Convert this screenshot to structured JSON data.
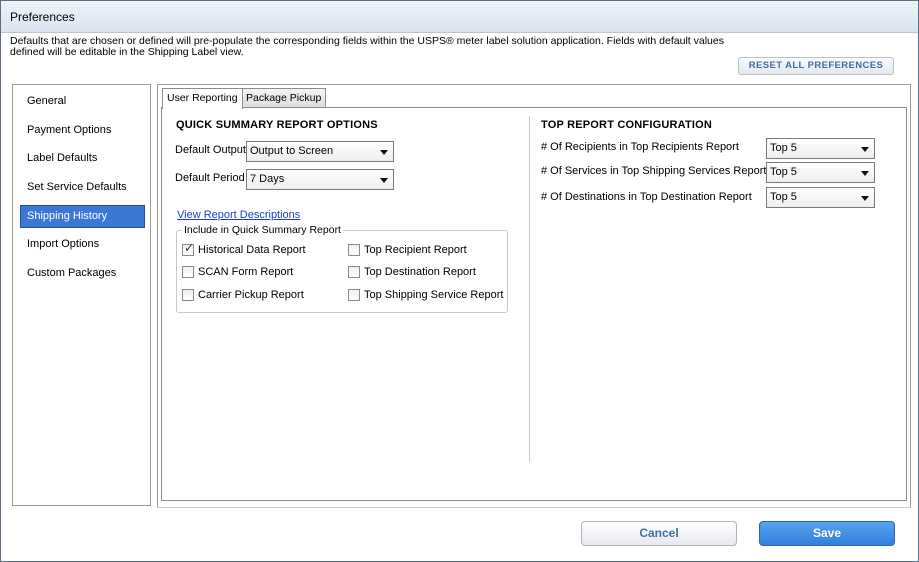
{
  "window": {
    "title": "Preferences"
  },
  "description": "Defaults that are chosen or defined will pre-populate the corresponding fields within the USPS® meter label solution application.  Fields with default values defined will be editable in the Shipping Label view.",
  "reset_label": "RESET ALL PREFERENCES",
  "sidebar": {
    "items": [
      {
        "label": "General",
        "active": false
      },
      {
        "label": "Payment Options",
        "active": false
      },
      {
        "label": "Label Defaults",
        "active": false
      },
      {
        "label": "Set Service Defaults",
        "active": false
      },
      {
        "label": "Shipping History",
        "active": true
      },
      {
        "label": "Import Options",
        "active": false
      },
      {
        "label": "Custom Packages",
        "active": false
      }
    ]
  },
  "tabs": [
    {
      "label": "User Reporting",
      "active": true
    },
    {
      "label": "Package Pickup",
      "active": false
    }
  ],
  "quick_summary": {
    "title": "QUICK SUMMARY REPORT OPTIONS",
    "default_output_label": "Default Output",
    "default_output_value": "Output to Screen",
    "default_period_label": "Default Period",
    "default_period_value": "7 Days",
    "view_link": "View Report Descriptions",
    "include_label": "Include in Quick Summary Report",
    "checkboxes": [
      {
        "label": "Historical Data Report",
        "checked": true
      },
      {
        "label": "SCAN Form Report",
        "checked": false
      },
      {
        "label": "Carrier Pickup Report",
        "checked": false
      },
      {
        "label": "Top Recipient Report",
        "checked": false
      },
      {
        "label": "Top Destination Report",
        "checked": false
      },
      {
        "label": "Top Shipping Service Report",
        "checked": false
      }
    ]
  },
  "top_report": {
    "title": "TOP REPORT CONFIGURATION",
    "rows": [
      {
        "label": "# Of Recipients in Top Recipients Report",
        "value": "Top 5"
      },
      {
        "label": "# Of Services in Top Shipping Services Report",
        "value": "Top 5"
      },
      {
        "label": "# Of Destinations in Top Destination Report",
        "value": "Top 5"
      }
    ]
  },
  "footer": {
    "cancel_label": "Cancel",
    "save_label": "Save"
  },
  "colors": {
    "accent": "#3b78d6",
    "save": "#2f7fdc",
    "link": "#1a3fd6"
  },
  "icons": [
    "chevron-down-icon",
    "check-icon"
  ]
}
